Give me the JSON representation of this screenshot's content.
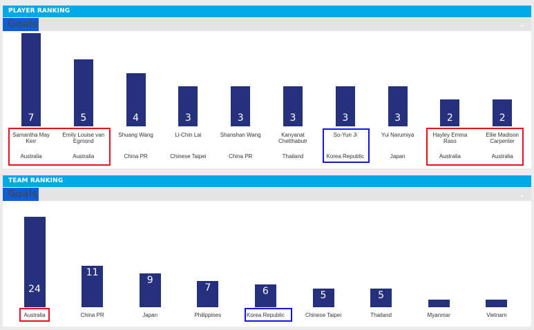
{
  "player_ranking": {
    "header": "PLAYER RANKING",
    "tab": "Goals",
    "players": [
      {
        "name": "Samantha May Kerr",
        "country": "Australia",
        "goals": "7"
      },
      {
        "name": "Emily Louise van Egmond",
        "country": "Australia",
        "goals": "5"
      },
      {
        "name": "Shuang Wang",
        "country": "China PR",
        "goals": "4"
      },
      {
        "name": "Li-Chin Lai",
        "country": "Chinese Taipei",
        "goals": "3"
      },
      {
        "name": "Shanshan Wang",
        "country": "China PR",
        "goals": "3"
      },
      {
        "name": "Kanyanat Chetthabutr",
        "country": "Thailand",
        "goals": "3"
      },
      {
        "name": "So-Yun Ji",
        "country": "Korea Republic",
        "goals": "3"
      },
      {
        "name": "Yui Narumiya",
        "country": "Japan",
        "goals": "3"
      },
      {
        "name": "Hayley Emma Raso",
        "country": "Australia",
        "goals": "2"
      },
      {
        "name": "Ellie Madison Carpenter",
        "country": "Australia",
        "goals": "2"
      }
    ]
  },
  "team_ranking": {
    "header": "TEAM RANKING",
    "tab": "Goals",
    "teams": [
      {
        "name": "Australia",
        "goals": "24"
      },
      {
        "name": "China PR",
        "goals": "11"
      },
      {
        "name": "Japan",
        "goals": "9"
      },
      {
        "name": "Philippines",
        "goals": "7"
      },
      {
        "name": "Korea Republic",
        "goals": "6"
      },
      {
        "name": "Chinese Taipei",
        "goals": "5"
      },
      {
        "name": "Thailand",
        "goals": "5"
      },
      {
        "name": "Myanmar",
        "goals": "2"
      },
      {
        "name": "Vietnam",
        "goals": "2"
      }
    ]
  },
  "icons": {
    "collapse": "chevron-down-icon"
  },
  "colors": {
    "header": "#00a9e6",
    "bar": "#26317e",
    "tab": "#0b5ed7",
    "highlight_red": "#e8101c",
    "highlight_blue": "#1414e0"
  }
}
